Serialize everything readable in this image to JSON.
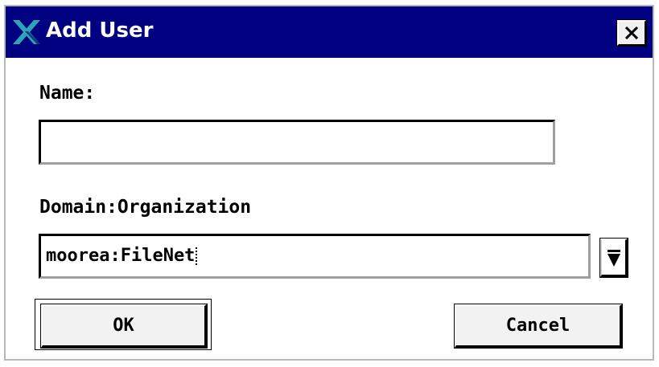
{
  "window": {
    "title": "Add User",
    "close_label": "×"
  },
  "form": {
    "name_label": "Name:",
    "name_value": "",
    "domain_label": "Domain:Organization",
    "domain_value": "moorea:FileNet"
  },
  "buttons": {
    "ok_label": "OK",
    "cancel_label": "Cancel"
  },
  "icons": {
    "app": "x-logo-icon",
    "close": "close-icon",
    "dropdown": "dropdown-arrow-icon"
  },
  "colors": {
    "titlebar": "#000080",
    "logo": "#2aa6b8"
  }
}
